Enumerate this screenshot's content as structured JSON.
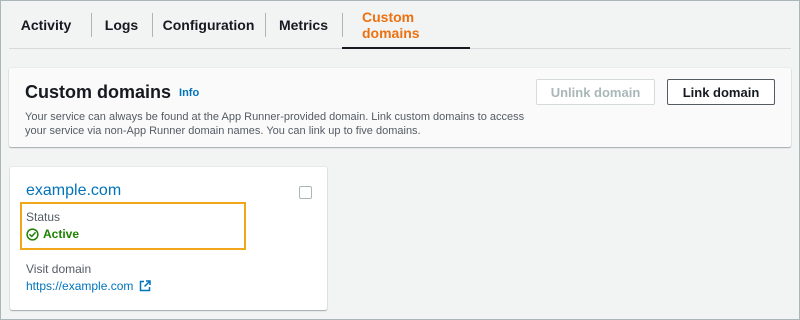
{
  "tabs": [
    {
      "label": "Activity",
      "active": false
    },
    {
      "label": "Logs",
      "active": false
    },
    {
      "label": "Configuration",
      "active": false
    },
    {
      "label": "Metrics",
      "active": false
    },
    {
      "label": "Custom domains",
      "active": true
    }
  ],
  "panel": {
    "title": "Custom domains",
    "info": "Info",
    "description": "Your service can always be found at the App Runner-provided domain. Link custom domains to access your service via non-App Runner domain names. You can link up to five domains.",
    "unlink_label": "Unlink domain",
    "link_label": "Link domain"
  },
  "card": {
    "domain": "example.com",
    "checked": false,
    "status_label": "Status",
    "status_value": "Active",
    "visit_label": "Visit domain",
    "visit_url": "https://example.com"
  },
  "colors": {
    "accent": "#ec7211",
    "link": "#0073bb",
    "success": "#1d8102",
    "highlight": "#f0a81a"
  },
  "icons": {
    "status": "check-circle-icon",
    "external": "external-link-icon"
  }
}
